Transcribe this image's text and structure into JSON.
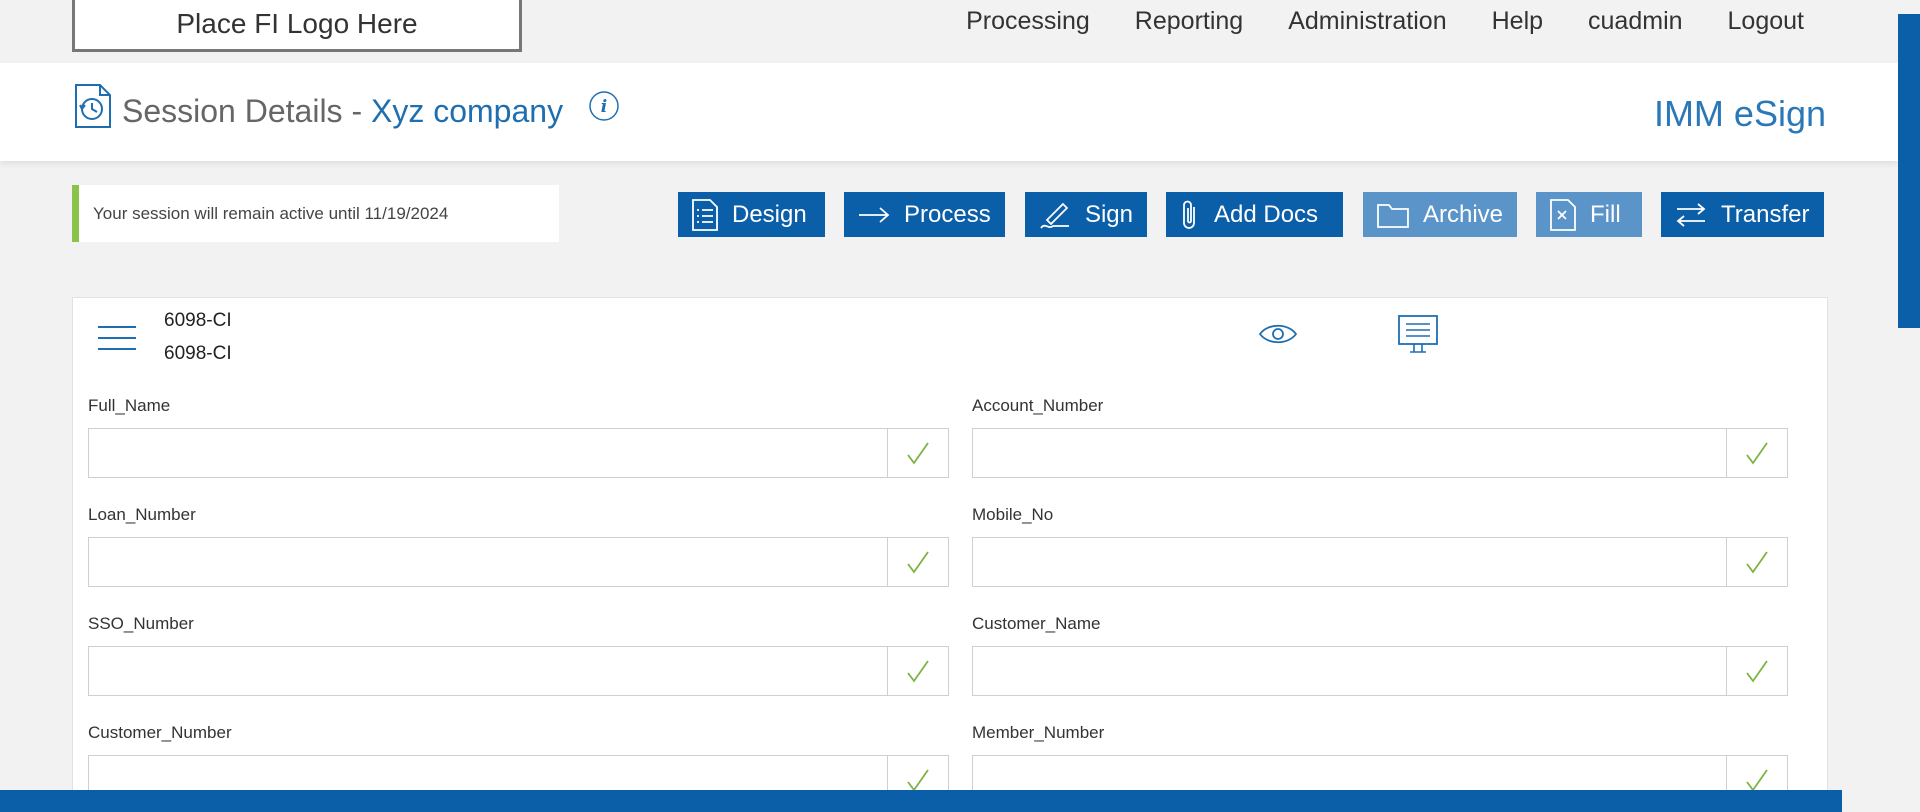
{
  "topbar": {
    "logo_text": "Place FI Logo Here",
    "nav": [
      "Processing",
      "Reporting",
      "Administration",
      "Help",
      "cuadmin",
      "Logout"
    ]
  },
  "header": {
    "title": "Session Details -",
    "company": "Xyz company",
    "brand": "IMM eSign"
  },
  "session": {
    "message": "Your session will remain active until 11/19/2024"
  },
  "actions": {
    "design": "Design",
    "process": "Process",
    "sign": "Sign",
    "add_docs": "Add Docs",
    "archive": "Archive",
    "fill": "Fill",
    "transfer": "Transfer"
  },
  "document": {
    "name_line1": "6098-CI",
    "name_line2": "6098-CI"
  },
  "fields": {
    "full_name": {
      "label": "Full_Name",
      "value": ""
    },
    "account_number": {
      "label": "Account_Number",
      "value": ""
    },
    "loan_number": {
      "label": "Loan_Number",
      "value": ""
    },
    "mobile_no": {
      "label": "Mobile_No",
      "value": ""
    },
    "sso_number": {
      "label": "SSO_Number",
      "value": ""
    },
    "customer_name": {
      "label": "Customer_Name",
      "value": ""
    },
    "customer_number": {
      "label": "Customer_Number",
      "value": ""
    },
    "member_number": {
      "label": "Member_Number",
      "value": ""
    }
  },
  "colors": {
    "primary": "#0b5ea8",
    "primary_light": "#5b94c8",
    "accent_green": "#8bc34a",
    "link_blue": "#1f6fb0"
  },
  "icons": {
    "header": "session-history-icon",
    "info": "info-icon",
    "menu": "hamburger-menu-icon",
    "preview": "eye-icon",
    "monitor": "monitor-icon",
    "check": "check-icon"
  }
}
